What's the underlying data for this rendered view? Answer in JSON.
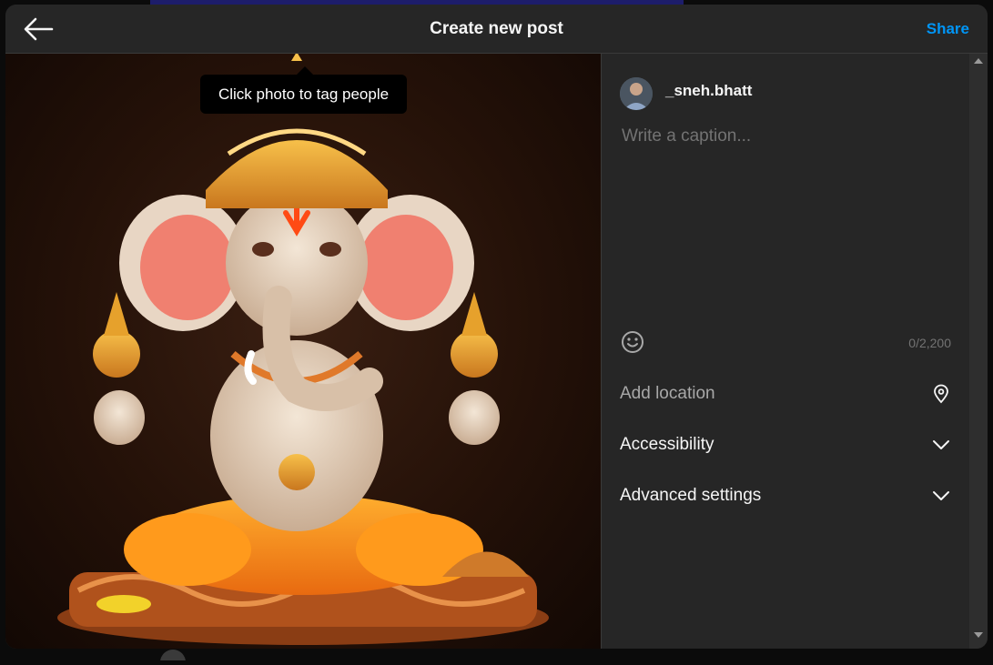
{
  "header": {
    "back_icon": "arrow-left-icon",
    "title": "Create new post",
    "share_label": "Share"
  },
  "photo": {
    "tooltip": "Click photo to tag people"
  },
  "user": {
    "username": "_sneh.bhatt"
  },
  "caption": {
    "placeholder": "Write a caption...",
    "value": "",
    "char_count": "0/2,200",
    "emoji_icon": "smiley-icon"
  },
  "options": {
    "location_label": "Add location",
    "location_icon": "location-pin-icon",
    "accessibility_label": "Accessibility",
    "advanced_label": "Advanced settings",
    "chevron_icon": "chevron-down-icon"
  },
  "colors": {
    "accent": "#0095f6",
    "background": "#262626",
    "text": "#f5f5f5",
    "muted": "#737373"
  }
}
